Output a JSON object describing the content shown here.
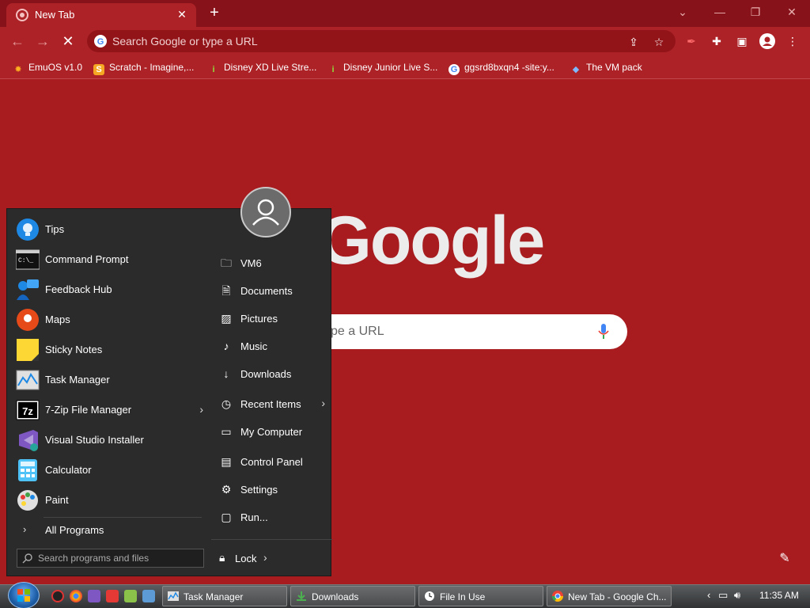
{
  "browser": {
    "tab_title": "New Tab",
    "omnibox_placeholder": "Search Google or type a URL",
    "bookmarks": [
      {
        "label": "EmuOS v1.0",
        "icon": "emuos-icon"
      },
      {
        "label": "Scratch - Imagine,...",
        "icon": "scratch-icon"
      },
      {
        "label": "Disney XD Live Stre...",
        "icon": "info-icon"
      },
      {
        "label": "Disney Junior Live S...",
        "icon": "info-icon"
      },
      {
        "label": "ggsrd8bxqn4 -site:y...",
        "icon": "google-icon"
      },
      {
        "label": "The VM pack",
        "icon": "vm-icon"
      }
    ]
  },
  "ntp": {
    "logo_text": "Google",
    "search_placeholder": "ype a URL"
  },
  "startmenu": {
    "apps": [
      {
        "label": "Tips",
        "icon": "tips-icon"
      },
      {
        "label": "Command Prompt",
        "icon": "command-prompt-icon"
      },
      {
        "label": "Feedback Hub",
        "icon": "feedback-hub-icon"
      },
      {
        "label": "Maps",
        "icon": "maps-icon"
      },
      {
        "label": "Sticky Notes",
        "icon": "sticky-notes-icon"
      },
      {
        "label": "Task Manager",
        "icon": "task-manager-icon"
      },
      {
        "label": "7-Zip File Manager",
        "icon": "seven-zip-icon"
      },
      {
        "label": "Visual Studio Installer",
        "icon": "vs-installer-icon"
      },
      {
        "label": "Calculator",
        "icon": "calculator-icon"
      },
      {
        "label": "Paint",
        "icon": "paint-icon"
      }
    ],
    "all_programs": "All Programs",
    "places": [
      {
        "label": "VM6",
        "icon": "folder-user-icon"
      },
      {
        "label": "Documents",
        "icon": "document-icon"
      },
      {
        "label": "Pictures",
        "icon": "picture-icon"
      },
      {
        "label": "Music",
        "icon": "music-icon"
      },
      {
        "label": "Downloads",
        "icon": "download-icon"
      },
      {
        "label": "Recent Items",
        "icon": "clock-icon"
      },
      {
        "label": "My Computer",
        "icon": "computer-icon"
      },
      {
        "label": "Control Panel",
        "icon": "control-panel-icon"
      },
      {
        "label": "Settings",
        "icon": "gear-icon"
      },
      {
        "label": "Run...",
        "icon": "run-icon"
      }
    ],
    "search_placeholder": "Search programs and files",
    "lock_label": "Lock"
  },
  "taskbar": {
    "tasks": [
      {
        "label": "Task Manager",
        "icon": "task-manager-icon"
      },
      {
        "label": "Downloads",
        "icon": "download-icon"
      },
      {
        "label": "File In Use",
        "icon": "clock-icon"
      },
      {
        "label": "New Tab - Google Ch...",
        "icon": "chrome-icon"
      }
    ],
    "time": "11:35 AM"
  },
  "colors": {
    "theme_red": "#a81c1f",
    "titlebar": "#87121a",
    "startmenu_bg": "#2b2b2b"
  }
}
